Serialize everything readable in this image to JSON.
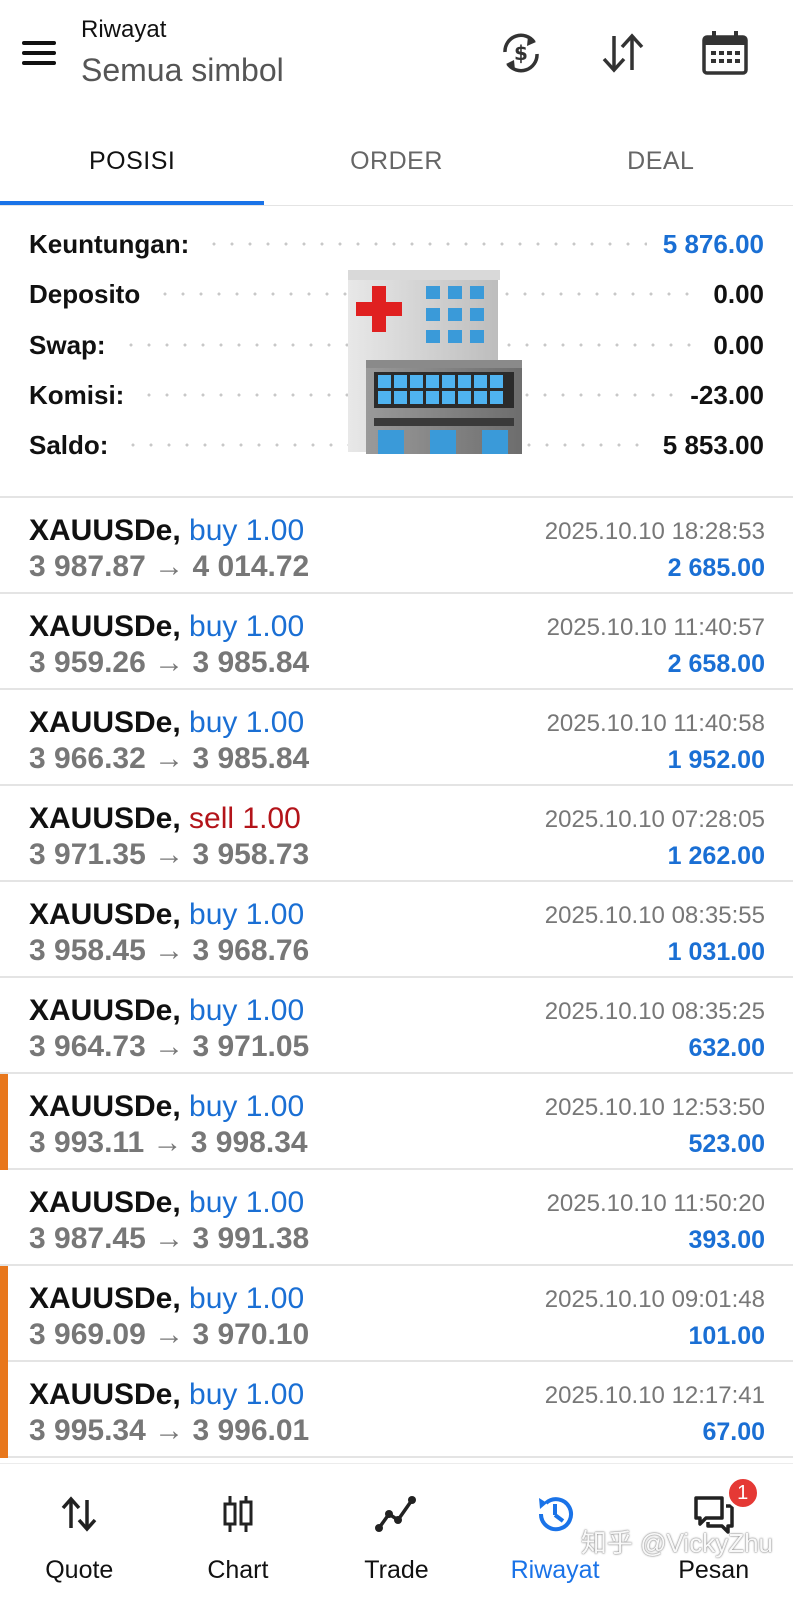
{
  "header": {
    "title": "Riwayat",
    "subtitle": "Semua simbol"
  },
  "tabs": [
    {
      "label": "POSISI",
      "active": true
    },
    {
      "label": "ORDER",
      "active": false
    },
    {
      "label": "DEAL",
      "active": false
    }
  ],
  "summary": {
    "profit_label": "Keuntungan:",
    "profit_value": "5 876.00",
    "deposit_label": "Deposito",
    "deposit_value": "0.00",
    "swap_label": "Swap:",
    "swap_value": "0.00",
    "commission_label": "Komisi:",
    "commission_value": "-23.00",
    "balance_label": "Saldo:",
    "balance_value": "5 853.00"
  },
  "deals": [
    {
      "symbol": "XAUUSDe,",
      "side": "buy 1.00",
      "type": "buy",
      "prices": "3 987.87 → 4 014.72",
      "time": "2025.10.10 18:28:53",
      "profit": "2 685.00",
      "marked": false
    },
    {
      "symbol": "XAUUSDe,",
      "side": "buy 1.00",
      "type": "buy",
      "prices": "3 959.26 → 3 985.84",
      "time": "2025.10.10 11:40:57",
      "profit": "2 658.00",
      "marked": false
    },
    {
      "symbol": "XAUUSDe,",
      "side": "buy 1.00",
      "type": "buy",
      "prices": "3 966.32 → 3 985.84",
      "time": "2025.10.10 11:40:58",
      "profit": "1 952.00",
      "marked": false
    },
    {
      "symbol": "XAUUSDe,",
      "side": "sell 1.00",
      "type": "sell",
      "prices": "3 971.35 → 3 958.73",
      "time": "2025.10.10 07:28:05",
      "profit": "1 262.00",
      "marked": false
    },
    {
      "symbol": "XAUUSDe,",
      "side": "buy 1.00",
      "type": "buy",
      "prices": "3 958.45 → 3 968.76",
      "time": "2025.10.10 08:35:55",
      "profit": "1 031.00",
      "marked": false
    },
    {
      "symbol": "XAUUSDe,",
      "side": "buy 1.00",
      "type": "buy",
      "prices": "3 964.73 → 3 971.05",
      "time": "2025.10.10 08:35:25",
      "profit": "632.00",
      "marked": false
    },
    {
      "symbol": "XAUUSDe,",
      "side": "buy 1.00",
      "type": "buy",
      "prices": "3 993.11 → 3 998.34",
      "time": "2025.10.10 12:53:50",
      "profit": "523.00",
      "marked": true
    },
    {
      "symbol": "XAUUSDe,",
      "side": "buy 1.00",
      "type": "buy",
      "prices": "3 987.45 → 3 991.38",
      "time": "2025.10.10 11:50:20",
      "profit": "393.00",
      "marked": false
    },
    {
      "symbol": "XAUUSDe,",
      "side": "buy 1.00",
      "type": "buy",
      "prices": "3 969.09 → 3 970.10",
      "time": "2025.10.10 09:01:48",
      "profit": "101.00",
      "marked": true
    },
    {
      "symbol": "XAUUSDe,",
      "side": "buy 1.00",
      "type": "buy",
      "prices": "3 995.34 → 3 996.01",
      "time": "2025.10.10 12:17:41",
      "profit": "67.00",
      "marked": true
    }
  ],
  "nav": {
    "items": [
      {
        "label": "Quote",
        "icon": "quote-arrows-icon"
      },
      {
        "label": "Chart",
        "icon": "candlestick-icon"
      },
      {
        "label": "Trade",
        "icon": "trade-line-icon"
      },
      {
        "label": "Riwayat",
        "icon": "history-icon",
        "active": true
      },
      {
        "label": "Pesan",
        "icon": "chat-icon",
        "badge": "1"
      }
    ]
  },
  "watermark": "知乎 @VickyZhu",
  "colors": {
    "accent": "#1a73e8",
    "profit_blue": "#1a6fd4",
    "sell_red": "#b3141a",
    "marker_orange": "#e8771c",
    "badge_red": "#e53935"
  }
}
